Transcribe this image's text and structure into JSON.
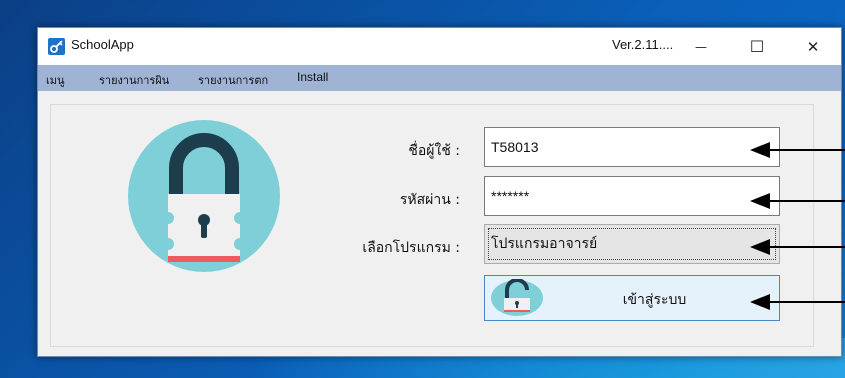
{
  "window": {
    "title": "SchoolApp",
    "version": "Ver.2.11....",
    "minimize_glyph": "—",
    "maximize_glyph": "☐",
    "close_glyph": "✕"
  },
  "menu": {
    "items": [
      "เมนู",
      "รายงานการผิน",
      "รายงานการตก",
      "Install"
    ]
  },
  "form": {
    "username_label": "ชื่อผู้ใช้ :",
    "username_value": "T58013",
    "password_label": "รหัสผ่าน :",
    "password_value": "*******",
    "program_label": "เลือกโปรแกรม :",
    "program_value": "โปรแกรมอาจารย์",
    "login_label": "เข้าสู่ระบบ"
  },
  "icons": {
    "app": "key-icon",
    "hero": "padlock-icon",
    "login": "unlocked-padlock-icon",
    "annotation": "arrow-left-icon"
  },
  "colors": {
    "lock_circle": "#7fcfd8",
    "lock_shackle": "#1d3c4c",
    "lock_body": "#f0f0f0",
    "lock_stripe": "#f05a5a",
    "menubar": "#9fb3d5",
    "button_border": "#4a86c7",
    "button_fill": "#e5f1fb"
  }
}
